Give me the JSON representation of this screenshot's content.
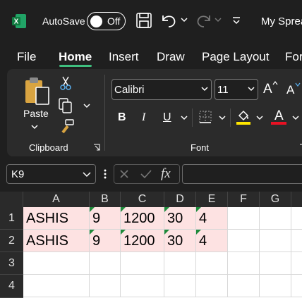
{
  "titlebar": {
    "app_icon": "excel-logo-icon",
    "autosave_label": "AutoSave",
    "autosave_state": "Off",
    "document_title": "My Spread"
  },
  "menu": {
    "items": [
      "File",
      "Home",
      "Insert",
      "Draw",
      "Page Layout",
      "For"
    ],
    "active": "Home"
  },
  "ribbon": {
    "clipboard": {
      "paste_label": "Paste",
      "group_label": "Clipboard"
    },
    "font": {
      "font_name": "Calibri",
      "font_size": "11",
      "group_label": "Font",
      "bold": "B",
      "italic": "I",
      "underline": "U",
      "grow": "A",
      "shrink": "A",
      "font_color_glyph": "A"
    }
  },
  "formula_bar": {
    "name_box": "K9",
    "fx": "fx",
    "formula": ""
  },
  "grid": {
    "columns": [
      "A",
      "B",
      "C",
      "D",
      "E",
      "F",
      "G"
    ],
    "rows": [
      "1",
      "2",
      "3",
      "4"
    ],
    "data": [
      [
        "ASHIS",
        "9",
        "1200",
        "30",
        "4"
      ],
      [
        "ASHIS",
        "9",
        "1200",
        "30",
        "4"
      ]
    ]
  },
  "colors": {
    "accent": "#3fbf7f",
    "fill_highlight": "#ffe600",
    "font_color": "#e81123",
    "selected_fill": "#fde2e2"
  }
}
